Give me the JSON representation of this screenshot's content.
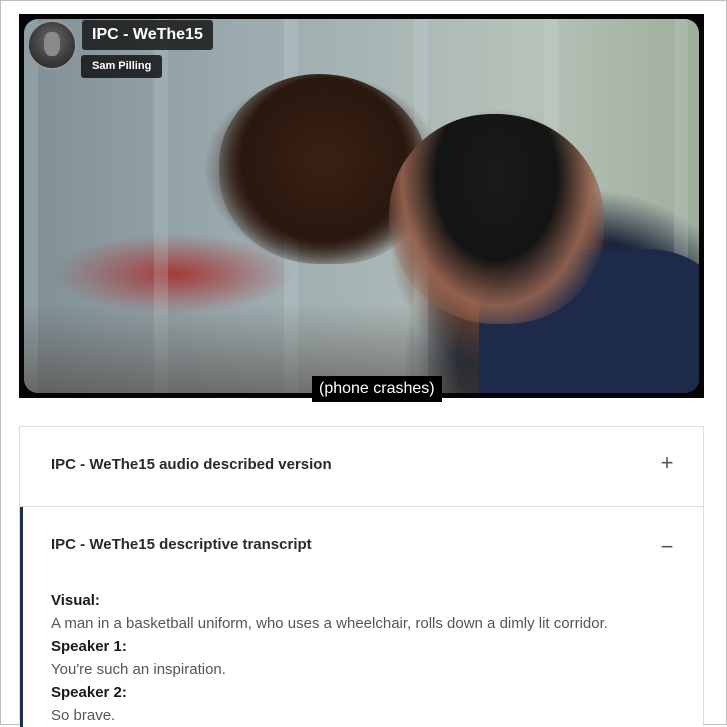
{
  "video": {
    "title": "IPC - WeThe15",
    "author": "Sam Pilling",
    "caption": "(phone crashes)"
  },
  "accordion": {
    "items": [
      {
        "title": "IPC - WeThe15 audio described version",
        "toggle": "+",
        "expanded": false
      },
      {
        "title": "IPC - WeThe15 descriptive transcript",
        "toggle": "−",
        "expanded": true
      }
    ],
    "transcript": [
      {
        "speaker": "Visual:",
        "text": "A man in a basketball uniform, who uses a wheelchair, rolls down a dimly lit corridor."
      },
      {
        "speaker": "Speaker 1:",
        "text": "You're such an inspiration."
      },
      {
        "speaker": "Speaker 2:",
        "text": "So brave."
      }
    ]
  },
  "colors": {
    "accent_border": "#1f3044",
    "caption_bg": "#000000",
    "pill_bg": "#141414"
  }
}
